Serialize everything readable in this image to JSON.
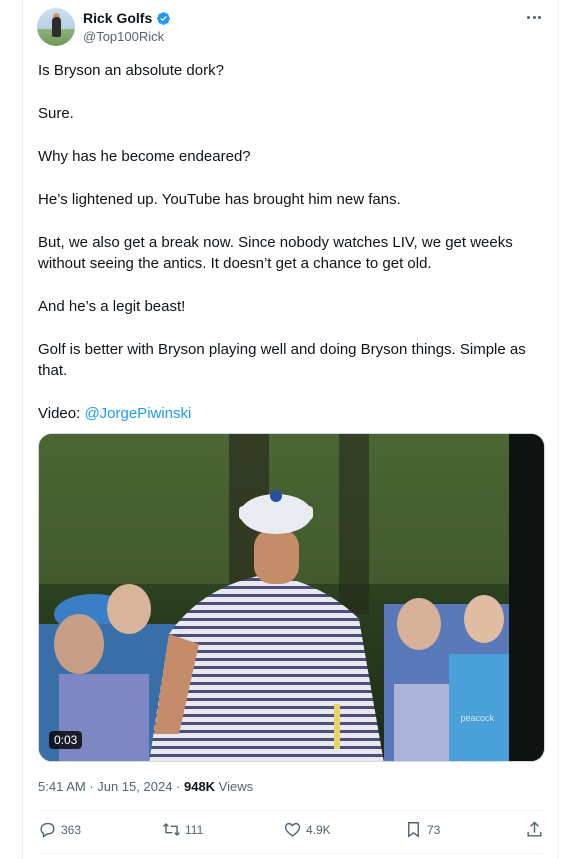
{
  "author": {
    "display_name": "Rick Golfs",
    "handle": "@Top100Rick",
    "verified": true
  },
  "tweet": {
    "paragraphs": [
      "Is Bryson an absolute dork?",
      "Sure.",
      "Why has he become endeared?",
      "He’s lightened up. YouTube has brought him new fans.",
      "But, we also get a break now. Since nobody watches LIV, we get weeks without seeing the antics. It doesn’t get a chance to get old.",
      "And he’s a legit beast!",
      "Golf is better with Bryson playing well and doing Bryson things. Simple as that."
    ],
    "video_prefix": "Video: ",
    "video_mention": "@JorgePiwinski"
  },
  "media": {
    "duration": "0:03",
    "watermark": "peacock"
  },
  "meta": {
    "time": "5:41 AM · Jun 15, 2024 · ",
    "views_count": "948K",
    "views_label": " Views"
  },
  "actions": {
    "replies": "363",
    "reposts": "111",
    "likes": "4.9K",
    "bookmarks": "73"
  },
  "colors": {
    "accent": "#1d9bf0",
    "text": "#0f1419",
    "muted": "#536471"
  }
}
